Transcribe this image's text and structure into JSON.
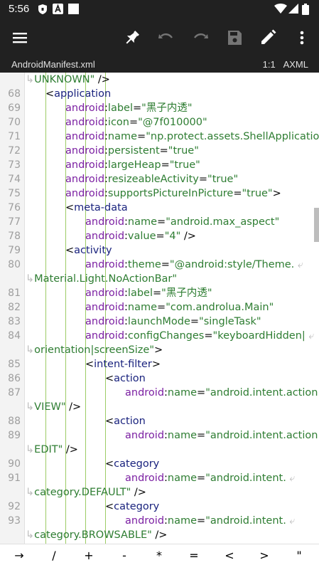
{
  "status_bar": {
    "time": "5:56"
  },
  "file_bar": {
    "file_name": "AndroidManifest.xml",
    "position": "1:1",
    "mode": "AXML"
  },
  "toolbar": {
    "icons": [
      "menu-icon",
      "pin-icon",
      "undo-icon",
      "redo-icon",
      "save-icon",
      "edit-icon",
      "more-icon"
    ]
  },
  "lines": [
    {
      "num": "",
      "text": "UNKNOWN\" />",
      "wrap": true
    },
    {
      "num": "68",
      "text": "<application"
    },
    {
      "num": "69",
      "ns": "android",
      "attr": "label",
      "val": "\"黑子内透\""
    },
    {
      "num": "70",
      "ns": "android",
      "attr": "icon",
      "val": "\"@7f010000\""
    },
    {
      "num": "71",
      "ns": "android",
      "attr": "name",
      "val": "\"np.protect.assets.ShellApplication\""
    },
    {
      "num": "72",
      "ns": "android",
      "attr": "persistent",
      "val": "\"true\""
    },
    {
      "num": "73",
      "ns": "android",
      "attr": "largeHeap",
      "val": "\"true\""
    },
    {
      "num": "74",
      "ns": "android",
      "attr": "resizeableActivity",
      "val": "\"true\""
    },
    {
      "num": "75",
      "ns": "android",
      "attr": "supportsPictureInPicture",
      "val": "\"true\">"
    },
    {
      "num": "76",
      "text": "<meta-data"
    },
    {
      "num": "77",
      "ns": "android",
      "attr": "name",
      "val": "\"android.max_aspect\""
    },
    {
      "num": "78",
      "ns": "android",
      "attr": "value",
      "val": "\"4\"  />"
    },
    {
      "num": "79",
      "text": "<activity"
    },
    {
      "num": "80",
      "ns": "android",
      "attr": "theme",
      "val": "\"@android:style/Theme."
    },
    {
      "num": "",
      "text": "Material.Light.NoActionBar\"",
      "wrap": true
    },
    {
      "num": "81",
      "ns": "android",
      "attr": "label",
      "val": "\"黑子内透\""
    },
    {
      "num": "82",
      "ns": "android",
      "attr": "name",
      "val": "\"com.androlua.Main\""
    },
    {
      "num": "83",
      "ns": "android",
      "attr": "launchMode",
      "val": "\"singleTask\""
    },
    {
      "num": "84",
      "ns": "android",
      "attr": "configChanges",
      "val": "\"keyboardHidden|"
    },
    {
      "num": "",
      "text": "orientation|screenSize\">",
      "wrap": true
    },
    {
      "num": "85",
      "text": "<intent-filter>"
    },
    {
      "num": "86",
      "text": "<action"
    },
    {
      "num": "87",
      "ns": "android",
      "attr": "name",
      "val": "\"android.intent.action."
    },
    {
      "num": "",
      "text": "VIEW\" />",
      "wrap": true
    },
    {
      "num": "88",
      "text": "<action"
    },
    {
      "num": "89",
      "ns": "android",
      "attr": "name",
      "val": "\"android.intent.action."
    },
    {
      "num": "",
      "text": "EDIT\"  />",
      "wrap": true
    },
    {
      "num": "90",
      "text": "<category"
    },
    {
      "num": "91",
      "ns": "android",
      "attr": "name",
      "val": "\"android.intent."
    },
    {
      "num": "",
      "text": "category.DEFAULT\" />",
      "wrap": true
    },
    {
      "num": "92",
      "text": "<category"
    },
    {
      "num": "93",
      "ns": "android",
      "attr": "name",
      "val": "\"android.intent."
    },
    {
      "num": "",
      "text": "category.BROWSABLE\" />",
      "wrap": true
    }
  ],
  "keys": [
    "→",
    "/",
    "+",
    "-",
    "*",
    "=",
    "<",
    ">",
    "\""
  ]
}
